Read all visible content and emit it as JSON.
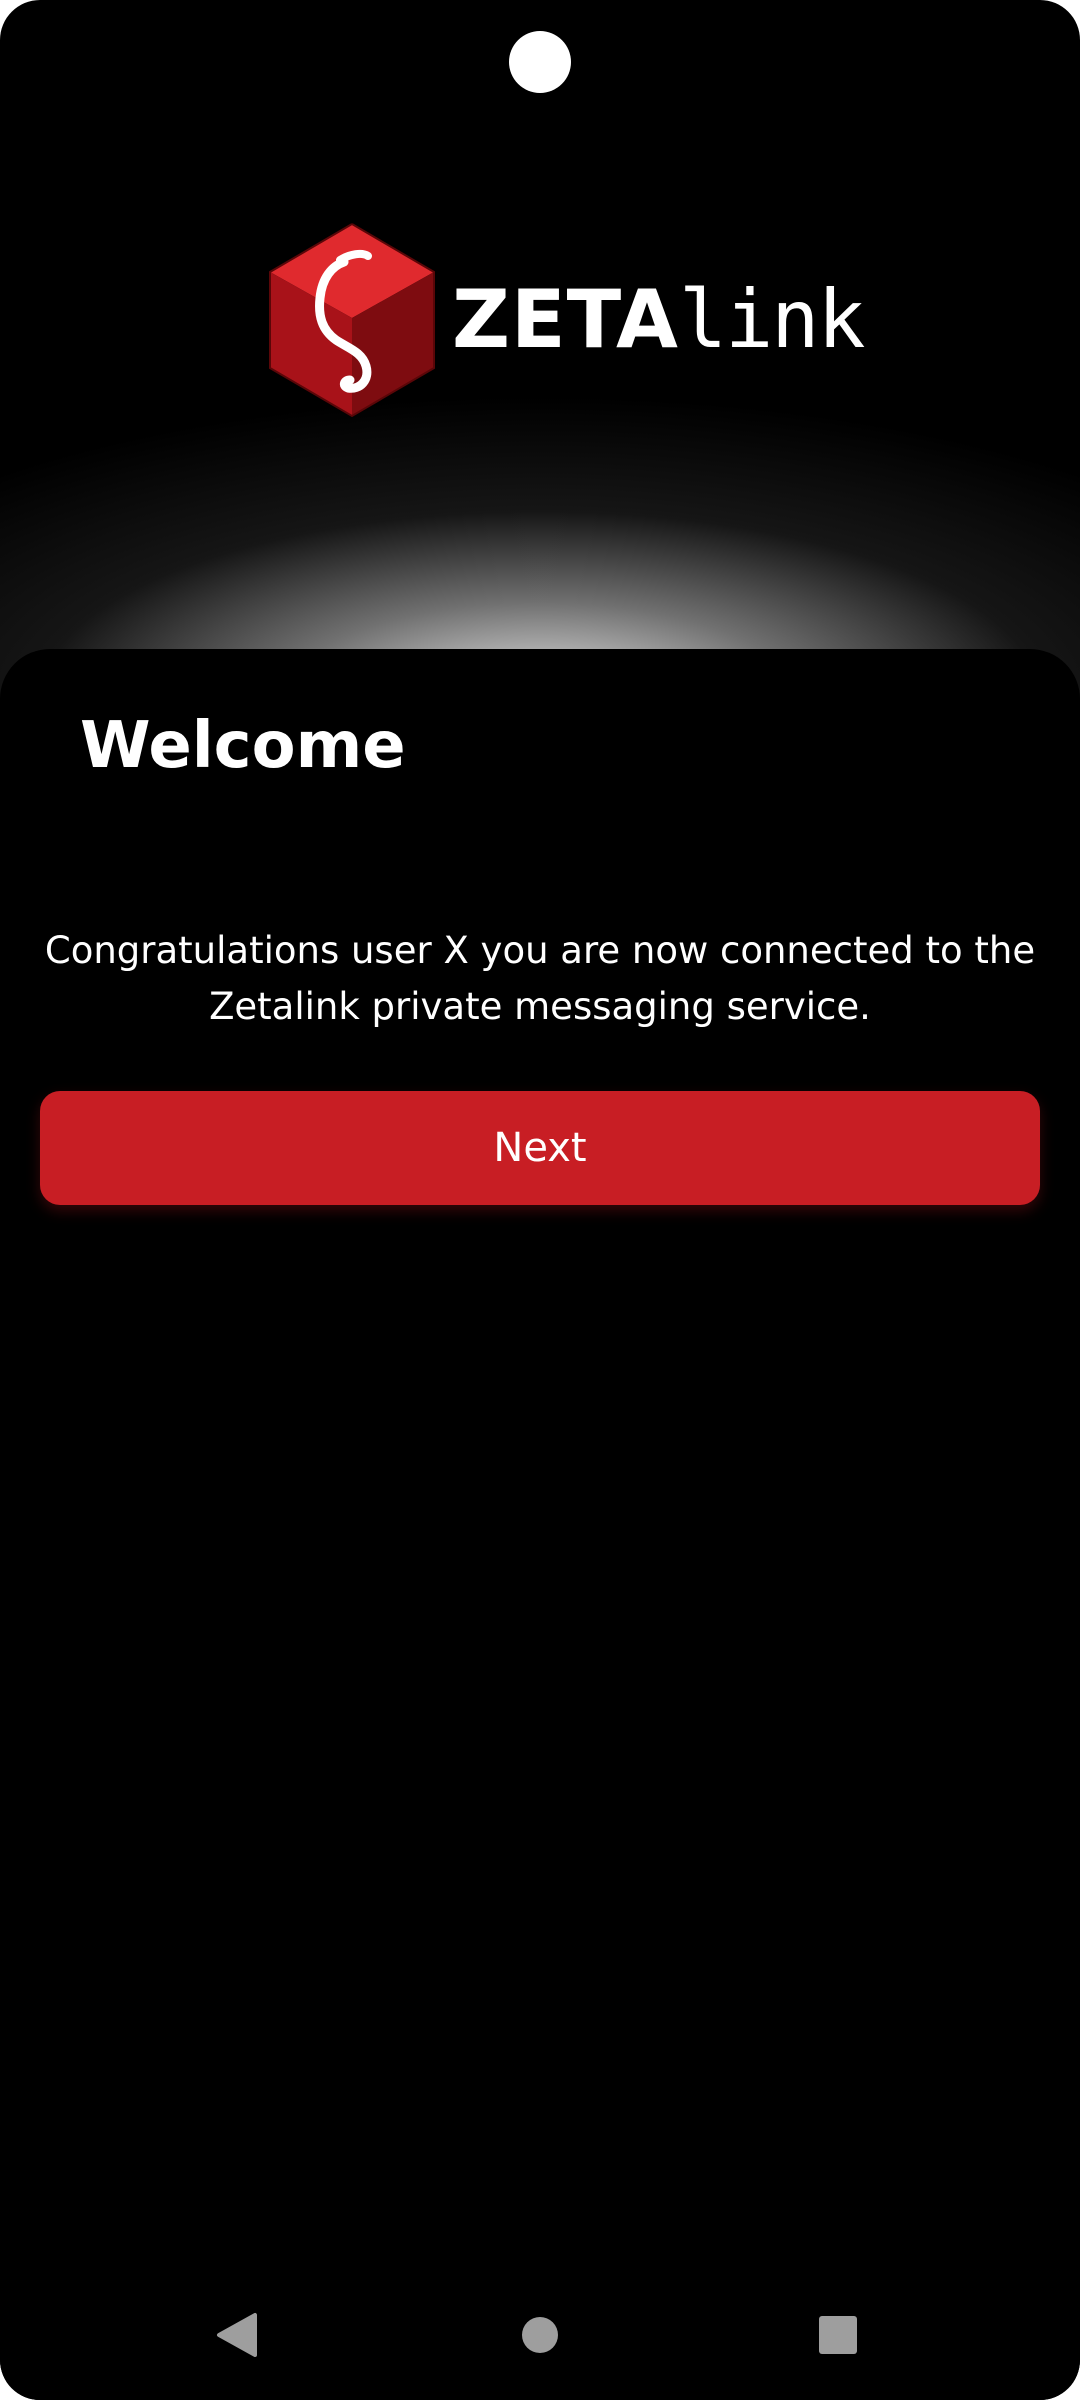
{
  "app": {
    "logo_wordmark_bold": "ZETA",
    "logo_wordmark_light": "link",
    "logo_icon": "zeta-cube-logo-icon"
  },
  "welcome": {
    "title": "Welcome",
    "message": "Congratulations user X you are now connected to the Zetalink private messaging service.",
    "next_label": "Next"
  },
  "nav": {
    "back_icon": "back-triangle-icon",
    "home_icon": "home-circle-icon",
    "recents_icon": "recents-square-icon"
  },
  "colors": {
    "background": "#000000",
    "accent": "#c81e24",
    "text": "#ffffff",
    "nav_icons": "#9e9e9e"
  }
}
